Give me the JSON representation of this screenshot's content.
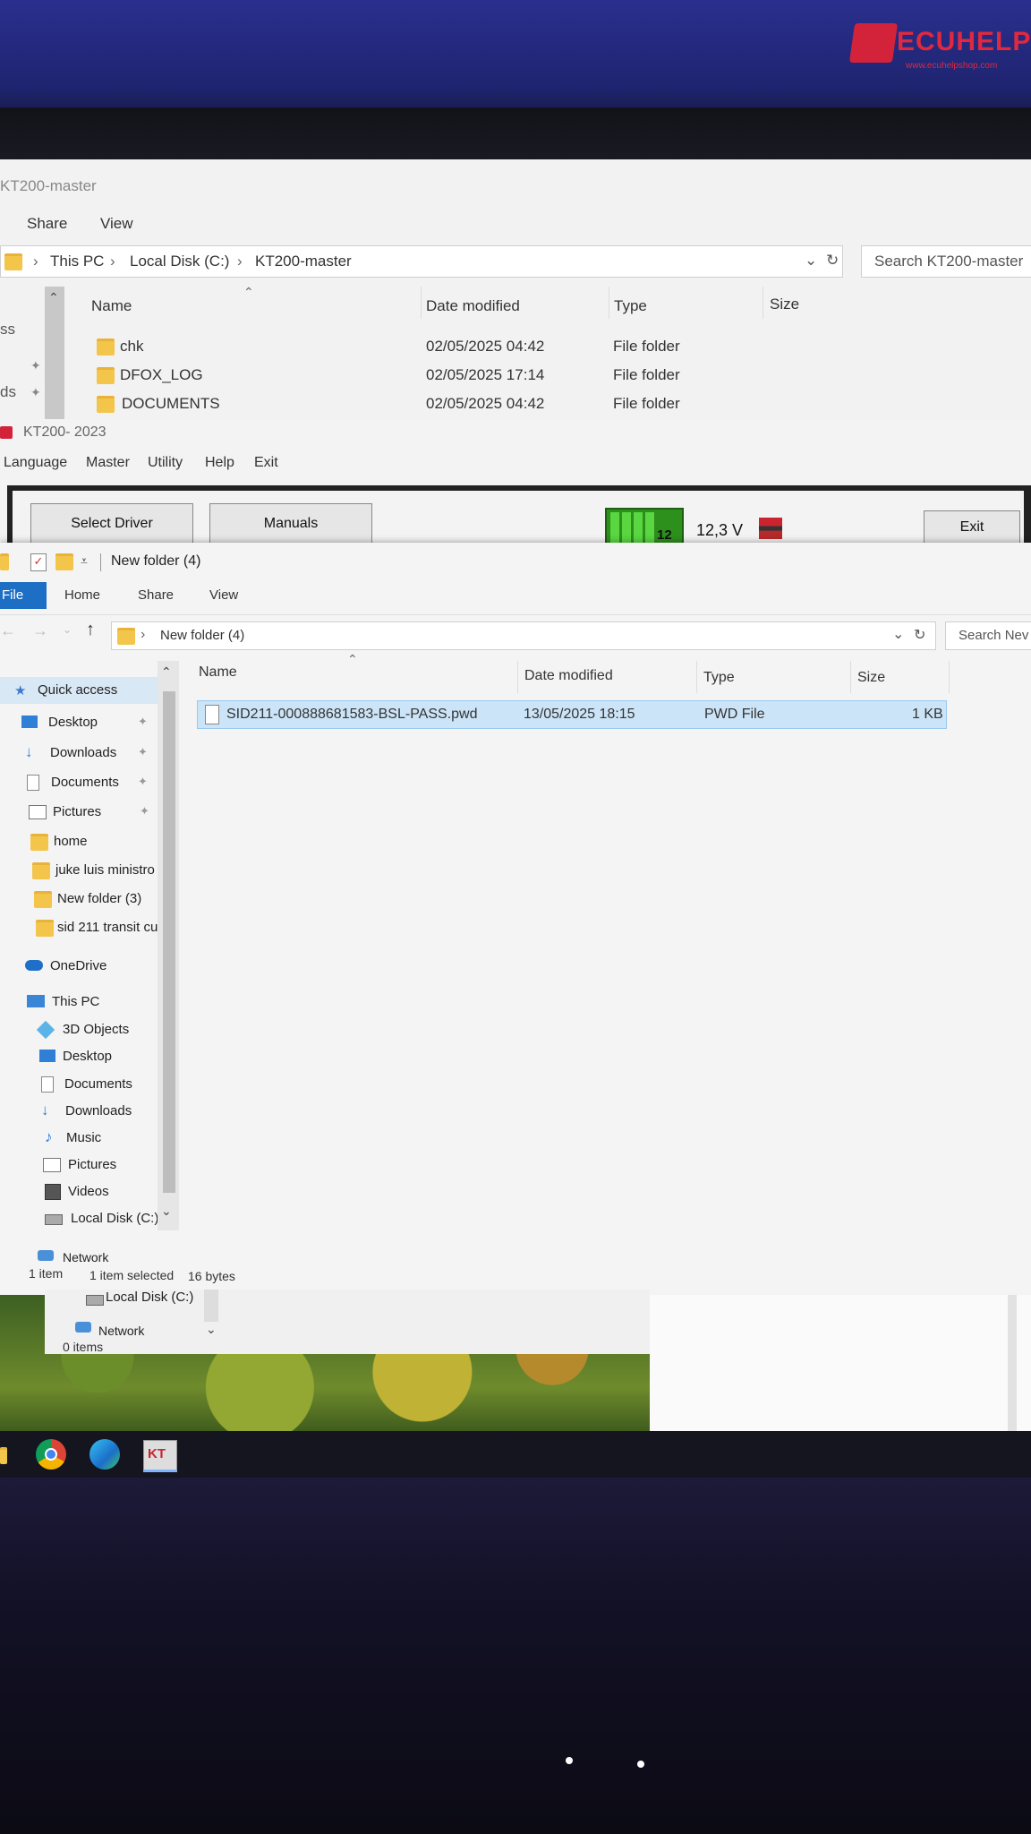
{
  "watermark": {
    "brand": "ECUHELP",
    "url": "www.ecuhelpshop.com",
    "accent": "#e0293e"
  },
  "back_explorer": {
    "title": "KT200-master",
    "menu": [
      "Share",
      "View"
    ],
    "breadcrumb": [
      "This PC",
      "Local Disk (C:)",
      "KT200-master"
    ],
    "search_placeholder": "Search KT200-master",
    "columns": [
      "Name",
      "Date modified",
      "Type",
      "Size"
    ],
    "left_fragments": [
      "ss",
      "ds"
    ],
    "rows": [
      {
        "name": "chk",
        "date": "02/05/2025 04:42",
        "type": "File folder"
      },
      {
        "name": "DFOX_LOG",
        "date": "02/05/2025 17:14",
        "type": "File folder"
      },
      {
        "name": "DOCUMENTS",
        "date": "02/05/2025 04:42",
        "type": "File folder"
      }
    ]
  },
  "kt200": {
    "title": "KT200- 2023",
    "menu": [
      "Language",
      "Master",
      "Utility",
      "Help",
      "Exit"
    ],
    "select_driver": "Select Driver",
    "manuals": "Manuals",
    "battery_partial": "12",
    "voltage": "12,3 V",
    "exit": "Exit"
  },
  "front_explorer": {
    "title": "New folder (4)",
    "ribbon_tabs": [
      "File",
      "Home",
      "Share",
      "View"
    ],
    "breadcrumb": "New folder (4)",
    "search_placeholder": "Search Nev",
    "columns": [
      "Name",
      "Date modified",
      "Type",
      "Size"
    ],
    "file": {
      "name": "SID211-000888681583-BSL-PASS.pwd",
      "date": "13/05/2025 18:15",
      "type": "PWD File",
      "size": "1 KB"
    },
    "nav": {
      "quick_access": "Quick access",
      "quick_items": [
        "Desktop",
        "Downloads",
        "Documents",
        "Pictures",
        "home",
        "juke luis ministro",
        "New folder (3)",
        "sid 211 transit cu"
      ],
      "onedrive": "OneDrive",
      "this_pc": "This PC",
      "pc_items": [
        "3D Objects",
        "Desktop",
        "Documents",
        "Downloads",
        "Music",
        "Pictures",
        "Videos",
        "Local Disk (C:)"
      ],
      "network": "Network"
    },
    "status": {
      "items": "1 item",
      "selected": "1 item selected",
      "size": "16 bytes"
    }
  },
  "lower_window": {
    "local_disk": "Local Disk (C:)",
    "network": "Network",
    "status": "0 items"
  },
  "taskbar": {
    "icons": [
      "folder-icon",
      "chrome-icon",
      "edge-icon",
      "kt200-icon"
    ],
    "kt_label": "KT"
  }
}
